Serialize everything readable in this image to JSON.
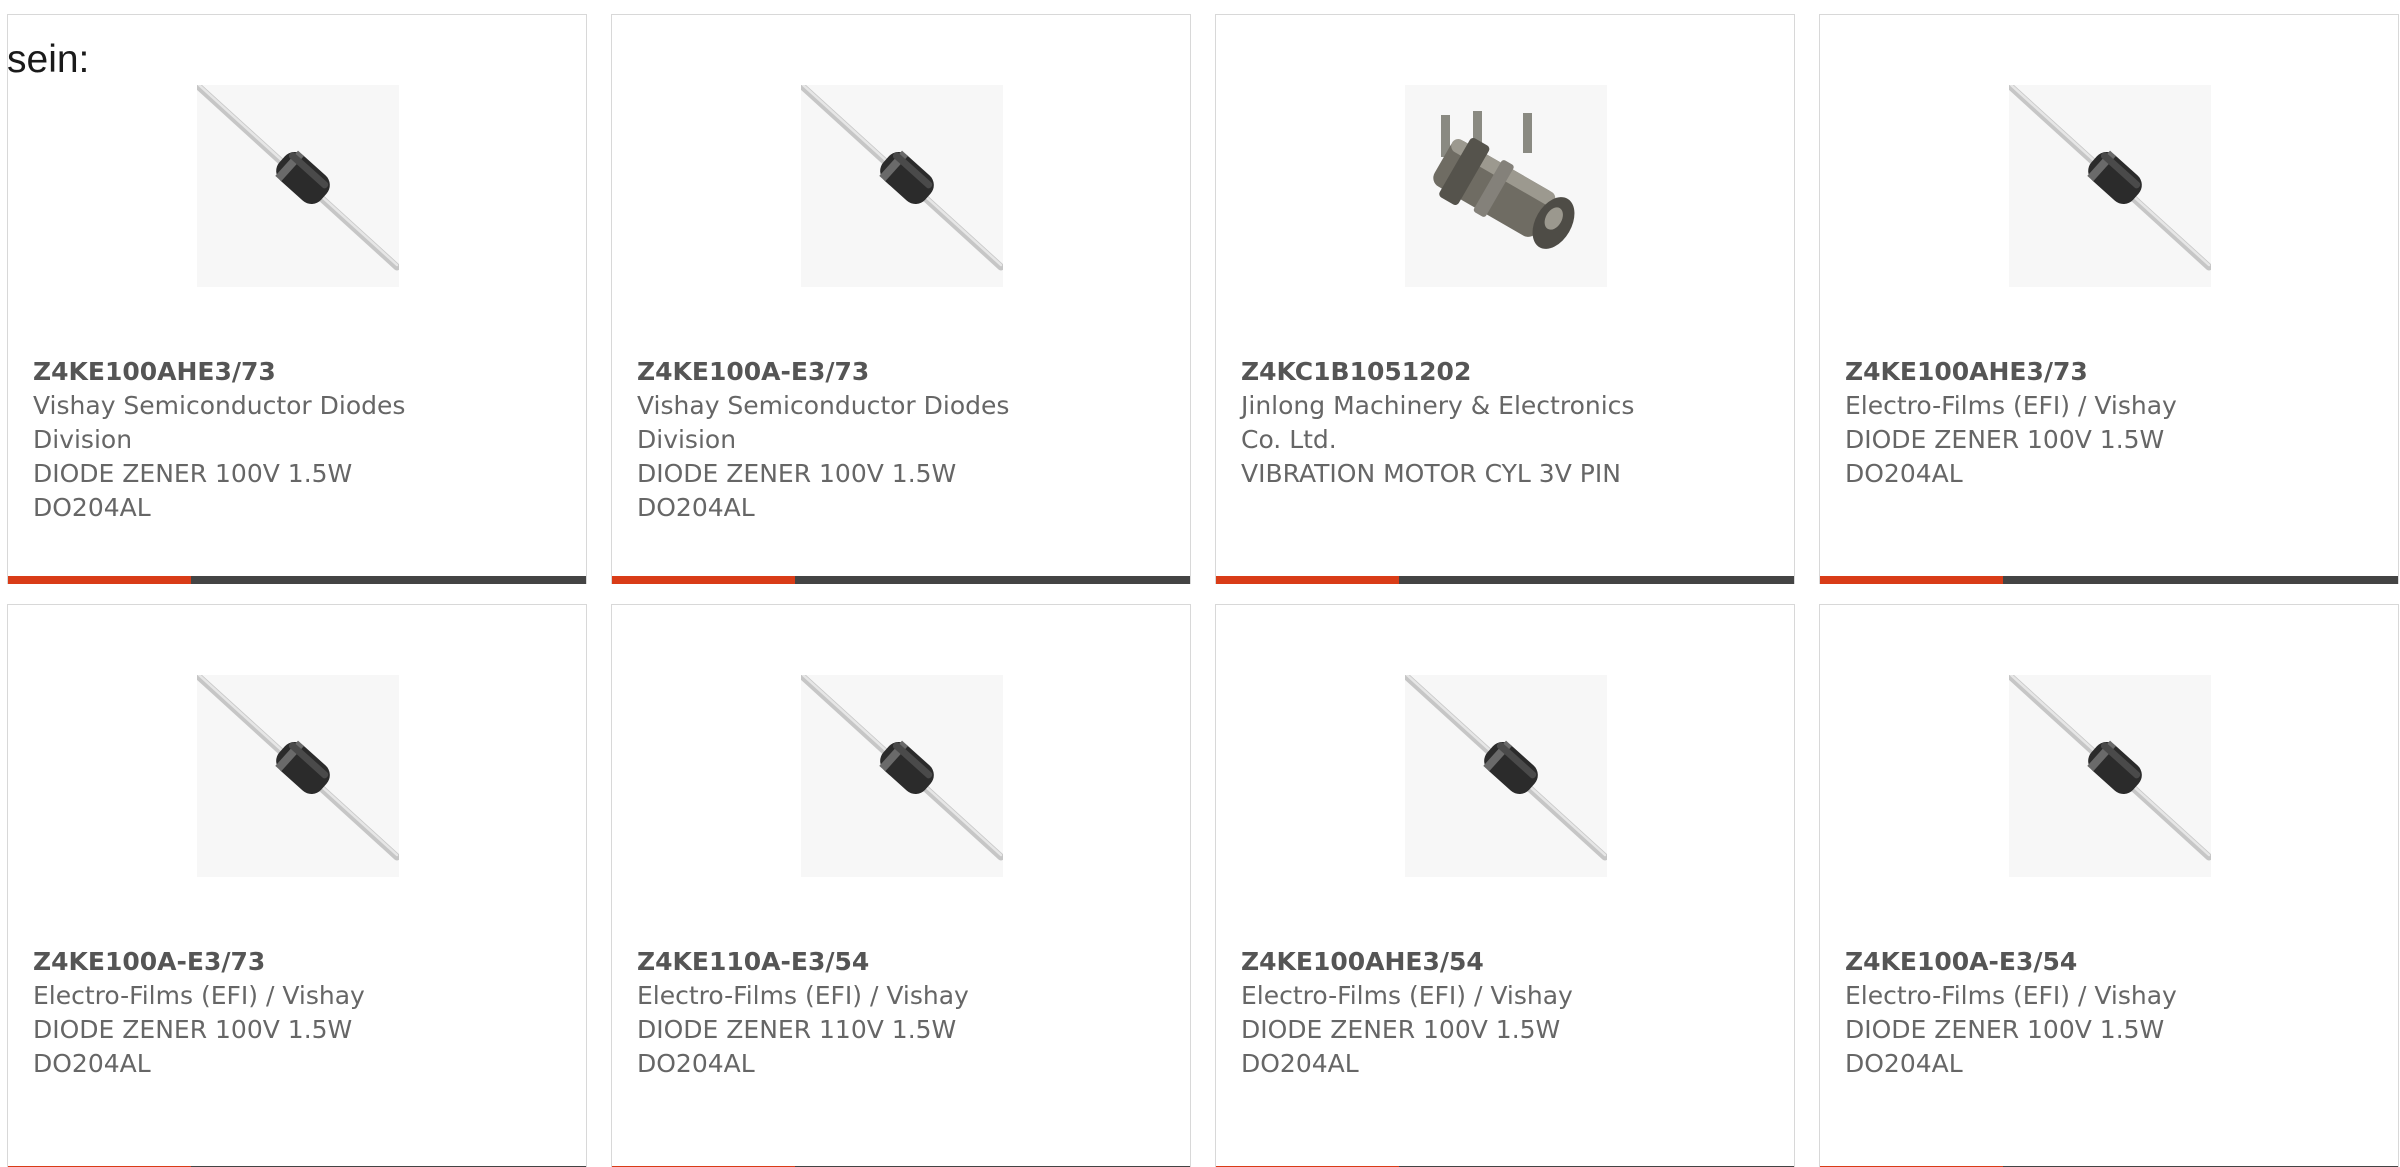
{
  "intro_text": "sein:",
  "colors": {
    "accent": "#d93c17",
    "bar_dark": "#444444",
    "text": "#666666"
  },
  "cards": [
    {
      "part_number": "Z4KE100AHE3/73",
      "manufacturer": "Vishay Semiconductor Diodes Division",
      "description": "DIODE ZENER 100V 1.5W DO204AL",
      "image": "diode-icon"
    },
    {
      "part_number": "Z4KE100A-E3/73",
      "manufacturer": "Vishay Semiconductor Diodes Division",
      "description": "DIODE ZENER 100V 1.5W DO204AL",
      "image": "diode-icon"
    },
    {
      "part_number": "Z4KC1B1051202",
      "manufacturer": "Jinlong Machinery & Electronics Co. Ltd.",
      "description": "VIBRATION MOTOR CYL 3V PIN",
      "image": "vibration-motor-icon"
    },
    {
      "part_number": "Z4KE100AHE3/73",
      "manufacturer": "Electro-Films (EFI) / Vishay",
      "description": "DIODE ZENER 100V 1.5W DO204AL",
      "image": "diode-icon"
    },
    {
      "part_number": "Z4KE100A-E3/73",
      "manufacturer": "Electro-Films (EFI) / Vishay",
      "description": "DIODE ZENER 100V 1.5W DO204AL",
      "image": "diode-icon"
    },
    {
      "part_number": "Z4KE110A-E3/54",
      "manufacturer": "Electro-Films (EFI) / Vishay",
      "description": "DIODE ZENER 110V 1.5W DO204AL",
      "image": "diode-icon"
    },
    {
      "part_number": "Z4KE100AHE3/54",
      "manufacturer": "Electro-Films (EFI) / Vishay",
      "description": "DIODE ZENER 100V 1.5W DO204AL",
      "image": "diode-icon"
    },
    {
      "part_number": "Z4KE100A-E3/54",
      "manufacturer": "Electro-Films (EFI) / Vishay",
      "description": "DIODE ZENER 100V 1.5W DO204AL",
      "image": "diode-icon"
    }
  ]
}
